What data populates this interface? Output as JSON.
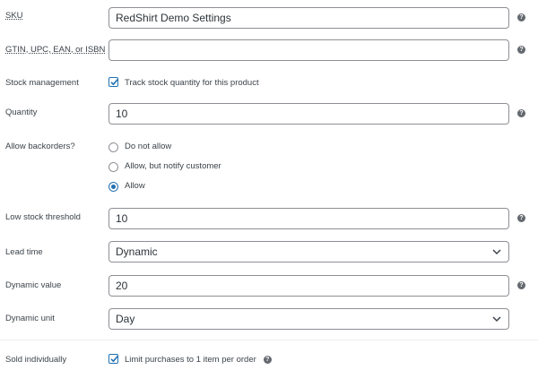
{
  "fields": {
    "sku": {
      "label": "SKU",
      "value": "RedShirt Demo Settings"
    },
    "gtin": {
      "label": "GTIN, UPC, EAN, or ISBN",
      "value": ""
    },
    "stock_management": {
      "label": "Stock management",
      "checkbox_label": "Track stock quantity for this product",
      "checked": true
    },
    "quantity": {
      "label": "Quantity",
      "value": "10"
    },
    "backorders": {
      "label": "Allow backorders?",
      "options": [
        "Do not allow",
        "Allow, but notify customer",
        "Allow"
      ],
      "selected": "Allow"
    },
    "low_stock": {
      "label": "Low stock threshold",
      "value": "10"
    },
    "lead_time": {
      "label": "Lead time",
      "value": "Dynamic"
    },
    "dynamic_value": {
      "label": "Dynamic value",
      "value": "20"
    },
    "dynamic_unit": {
      "label": "Dynamic unit",
      "value": "Day"
    },
    "sold_individually": {
      "label": "Sold individually",
      "checkbox_label": "Limit purchases to 1 item per order",
      "checked": true
    }
  },
  "help_glyph": "?",
  "icons": {
    "help": "help-icon",
    "check": "checkmark-icon",
    "dropdown": "chevron-down-icon"
  },
  "colors": {
    "accent": "#2271b1",
    "border": "#8c8f94",
    "help": "#646970"
  }
}
